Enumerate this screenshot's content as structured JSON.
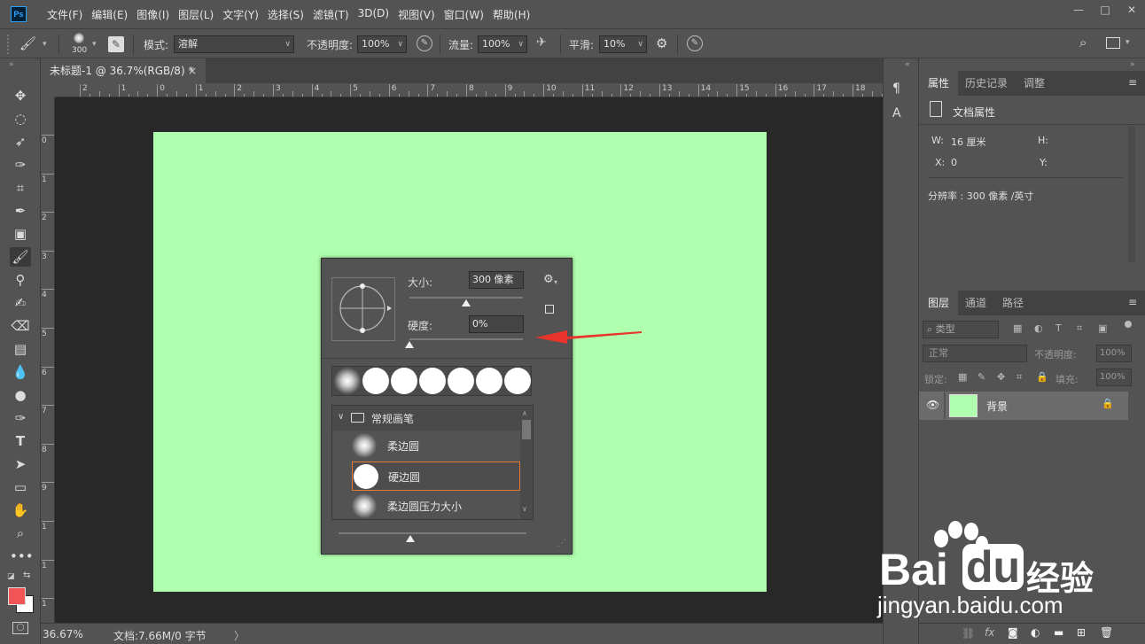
{
  "app": {
    "logo_text": "Ps"
  },
  "menu": [
    "文件(F)",
    "编辑(E)",
    "图像(I)",
    "图层(L)",
    "文字(Y)",
    "选择(S)",
    "滤镜(T)",
    "3D(D)",
    "视图(V)",
    "窗口(W)",
    "帮助(H)"
  ],
  "window_controls": {
    "minimize": "—",
    "maximize": "□",
    "close": "✕"
  },
  "options": {
    "brush_size": "300",
    "mode_label": "模式:",
    "mode_value": "溶解",
    "opacity_label": "不透明度:",
    "opacity_value": "100%",
    "flow_label": "流量:",
    "flow_value": "100%",
    "smooth_label": "平滑:",
    "smooth_value": "10%"
  },
  "document": {
    "tab_title": "未标题-1 @ 36.7%(RGB/8) *",
    "tab_close": "×",
    "canvas_color": "#b0ffae",
    "ruler_top": [
      "2",
      "1",
      "0",
      "1",
      "2",
      "3",
      "4",
      "5",
      "6",
      "7",
      "8",
      "9",
      "10",
      "11",
      "12",
      "13",
      "14",
      "15",
      "16",
      "17",
      "18"
    ],
    "ruler_left": [
      "0",
      "1",
      "2",
      "3",
      "4",
      "5",
      "6",
      "7",
      "8",
      "9",
      "1",
      "1",
      "1"
    ]
  },
  "status": {
    "zoom": "36.67%",
    "doc_info": "文档:7.66M/0 字节",
    "arrow": "〉"
  },
  "brush_picker": {
    "size_label": "大小:",
    "size_value": "300 像素",
    "size_fraction": 0.5,
    "hardness_label": "硬度:",
    "hardness_value": "0%",
    "hardness_fraction": 0.0,
    "group_name": "常规画笔",
    "brushes": [
      {
        "name": "柔边圆",
        "type": "soft",
        "selected": false
      },
      {
        "name": "硬边圆",
        "type": "hard",
        "selected": true
      },
      {
        "name": "柔边圆压力大小",
        "type": "soft",
        "selected": false
      }
    ],
    "recent": [
      "soft",
      "hard",
      "hard",
      "hard",
      "hard",
      "hard",
      "hard"
    ]
  },
  "annotation": {
    "arrow_color": "#e8342c"
  },
  "properties_panel": {
    "tabs": [
      "属性",
      "历史记录",
      "调整"
    ],
    "active_tab": "属性",
    "section_title": "文档属性",
    "w_label": "W:",
    "w_value": "16 厘米",
    "h_label": "H:",
    "h_value": "",
    "x_label": "X:",
    "x_value": "0",
    "y_label": "Y:",
    "y_value": "",
    "resolution": "分辨率 : 300 像素 /英寸"
  },
  "layers_panel": {
    "tabs": [
      "图层",
      "通道",
      "路径"
    ],
    "active_tab": "图层",
    "kind_filter": "类型",
    "blend_mode": "正常",
    "opacity_label": "不透明度:",
    "opacity_value": "100%",
    "lock_label": "锁定:",
    "fill_label": "填充:",
    "fill_value": "100%",
    "layer_name": "背景",
    "layer_color": "#b0ffae"
  },
  "colors": {
    "foreground": "#f05454",
    "background": "#ffffff"
  },
  "watermark": {
    "brand": "Bai",
    "brand2": "du",
    "cn": "经验",
    "url": "jingyan.baidu.com"
  }
}
